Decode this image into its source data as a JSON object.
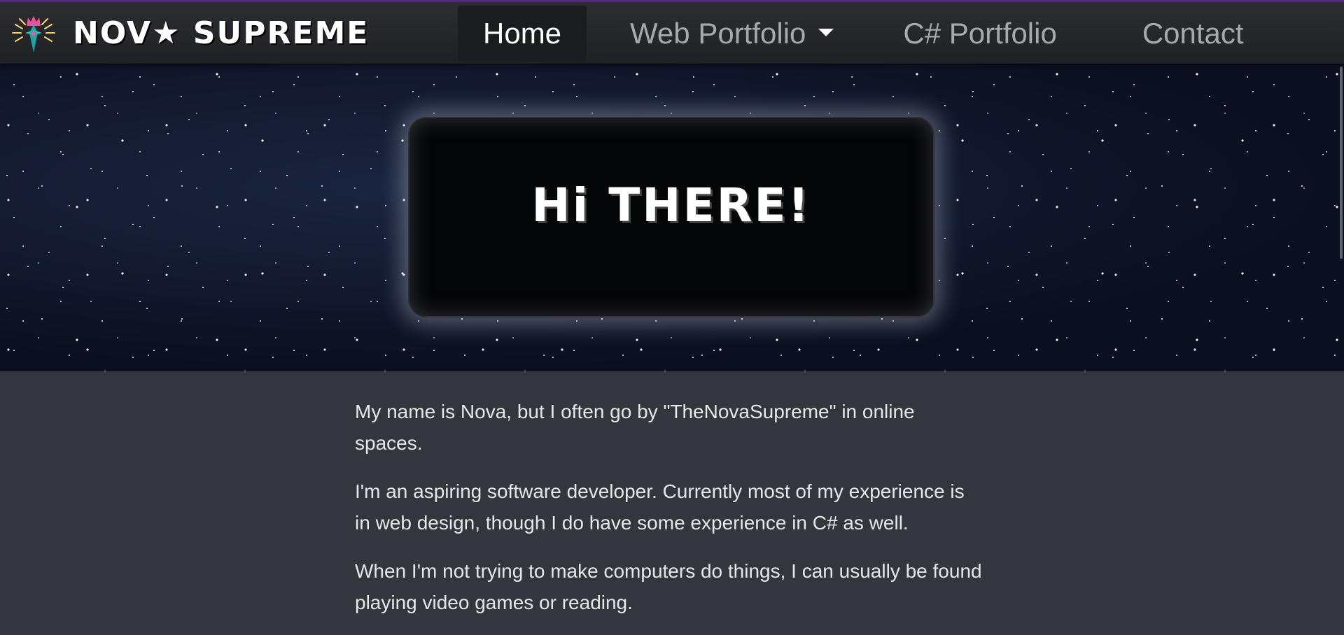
{
  "brand": {
    "name": "NOV★ SUPREME"
  },
  "nav": {
    "items": [
      {
        "label": "Home",
        "active": true
      },
      {
        "label": "Web Portfolio",
        "dropdown": true
      },
      {
        "label": "C# Portfolio"
      },
      {
        "label": "Contact"
      }
    ]
  },
  "hero": {
    "title": "Hi THERE!"
  },
  "about": {
    "paragraphs": [
      "My name is Nova, but I often go by \"TheNovaSupreme\" in online spaces.",
      "I'm an aspiring software developer. Currently most of my experience is in web design, though I do have some experience in C# as well.",
      "When I'm not trying to make computers do things, I can usually be found playing video games or reading."
    ]
  },
  "colors": {
    "navbar_bg": "#232529",
    "active_nav_bg": "#1a1c1f",
    "page_bg": "#33363d",
    "accent_strip": "#5b2a86",
    "text": "#e6e7e9"
  },
  "icons": {
    "logo": "crowned-star-logo-icon",
    "dropdown": "caret-down-icon"
  }
}
